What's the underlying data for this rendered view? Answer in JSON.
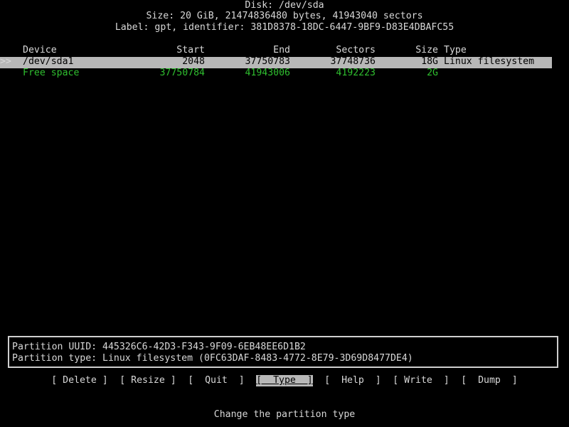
{
  "header": {
    "disk_title": "Disk: /dev/sda",
    "size_line": "Size: 20 GiB, 21474836480 bytes, 41943040 sectors",
    "label_line": "Label: gpt, identifier: 381D8378-18DC-6447-9BF9-D83E4DBAFC55"
  },
  "table": {
    "columns": [
      "Device",
      "Start",
      "End",
      "Sectors",
      "Size",
      "Type"
    ],
    "rows": [
      {
        "marker": ">>",
        "device": "/dev/sda1",
        "start": "2048",
        "end": "37750783",
        "sectors": "37748736",
        "size": "18G",
        "type": "Linux filesystem",
        "selected": true
      },
      {
        "marker": "",
        "device": "Free space",
        "start": "37750784",
        "end": "41943006",
        "sectors": "4192223",
        "size": "2G",
        "type": "",
        "selected": false
      }
    ]
  },
  "info": {
    "uuid_line": "Partition UUID: 445326C6-42D3-F343-9F09-6EB48EE6D1B2",
    "type_line": "Partition type: Linux filesystem (0FC63DAF-8483-4772-8E79-3D69D8477DE4)"
  },
  "menu": {
    "items": [
      {
        "label": "[ Delete ]",
        "active": false
      },
      {
        "label": "[ Resize ]",
        "active": false
      },
      {
        "label": "[  Quit  ]",
        "active": false
      },
      {
        "label": "[  Type  ]",
        "active": true
      },
      {
        "label": "[  Help  ]",
        "active": false
      },
      {
        "label": "[ Write  ]",
        "active": false
      },
      {
        "label": "[  Dump  ]",
        "active": false
      }
    ]
  },
  "status": {
    "hint": "Change the partition type"
  },
  "colors": {
    "background": "#000000",
    "foreground": "#d8d8d8",
    "selection": "#b8b8b8",
    "free_space": "#2fbf2f"
  }
}
